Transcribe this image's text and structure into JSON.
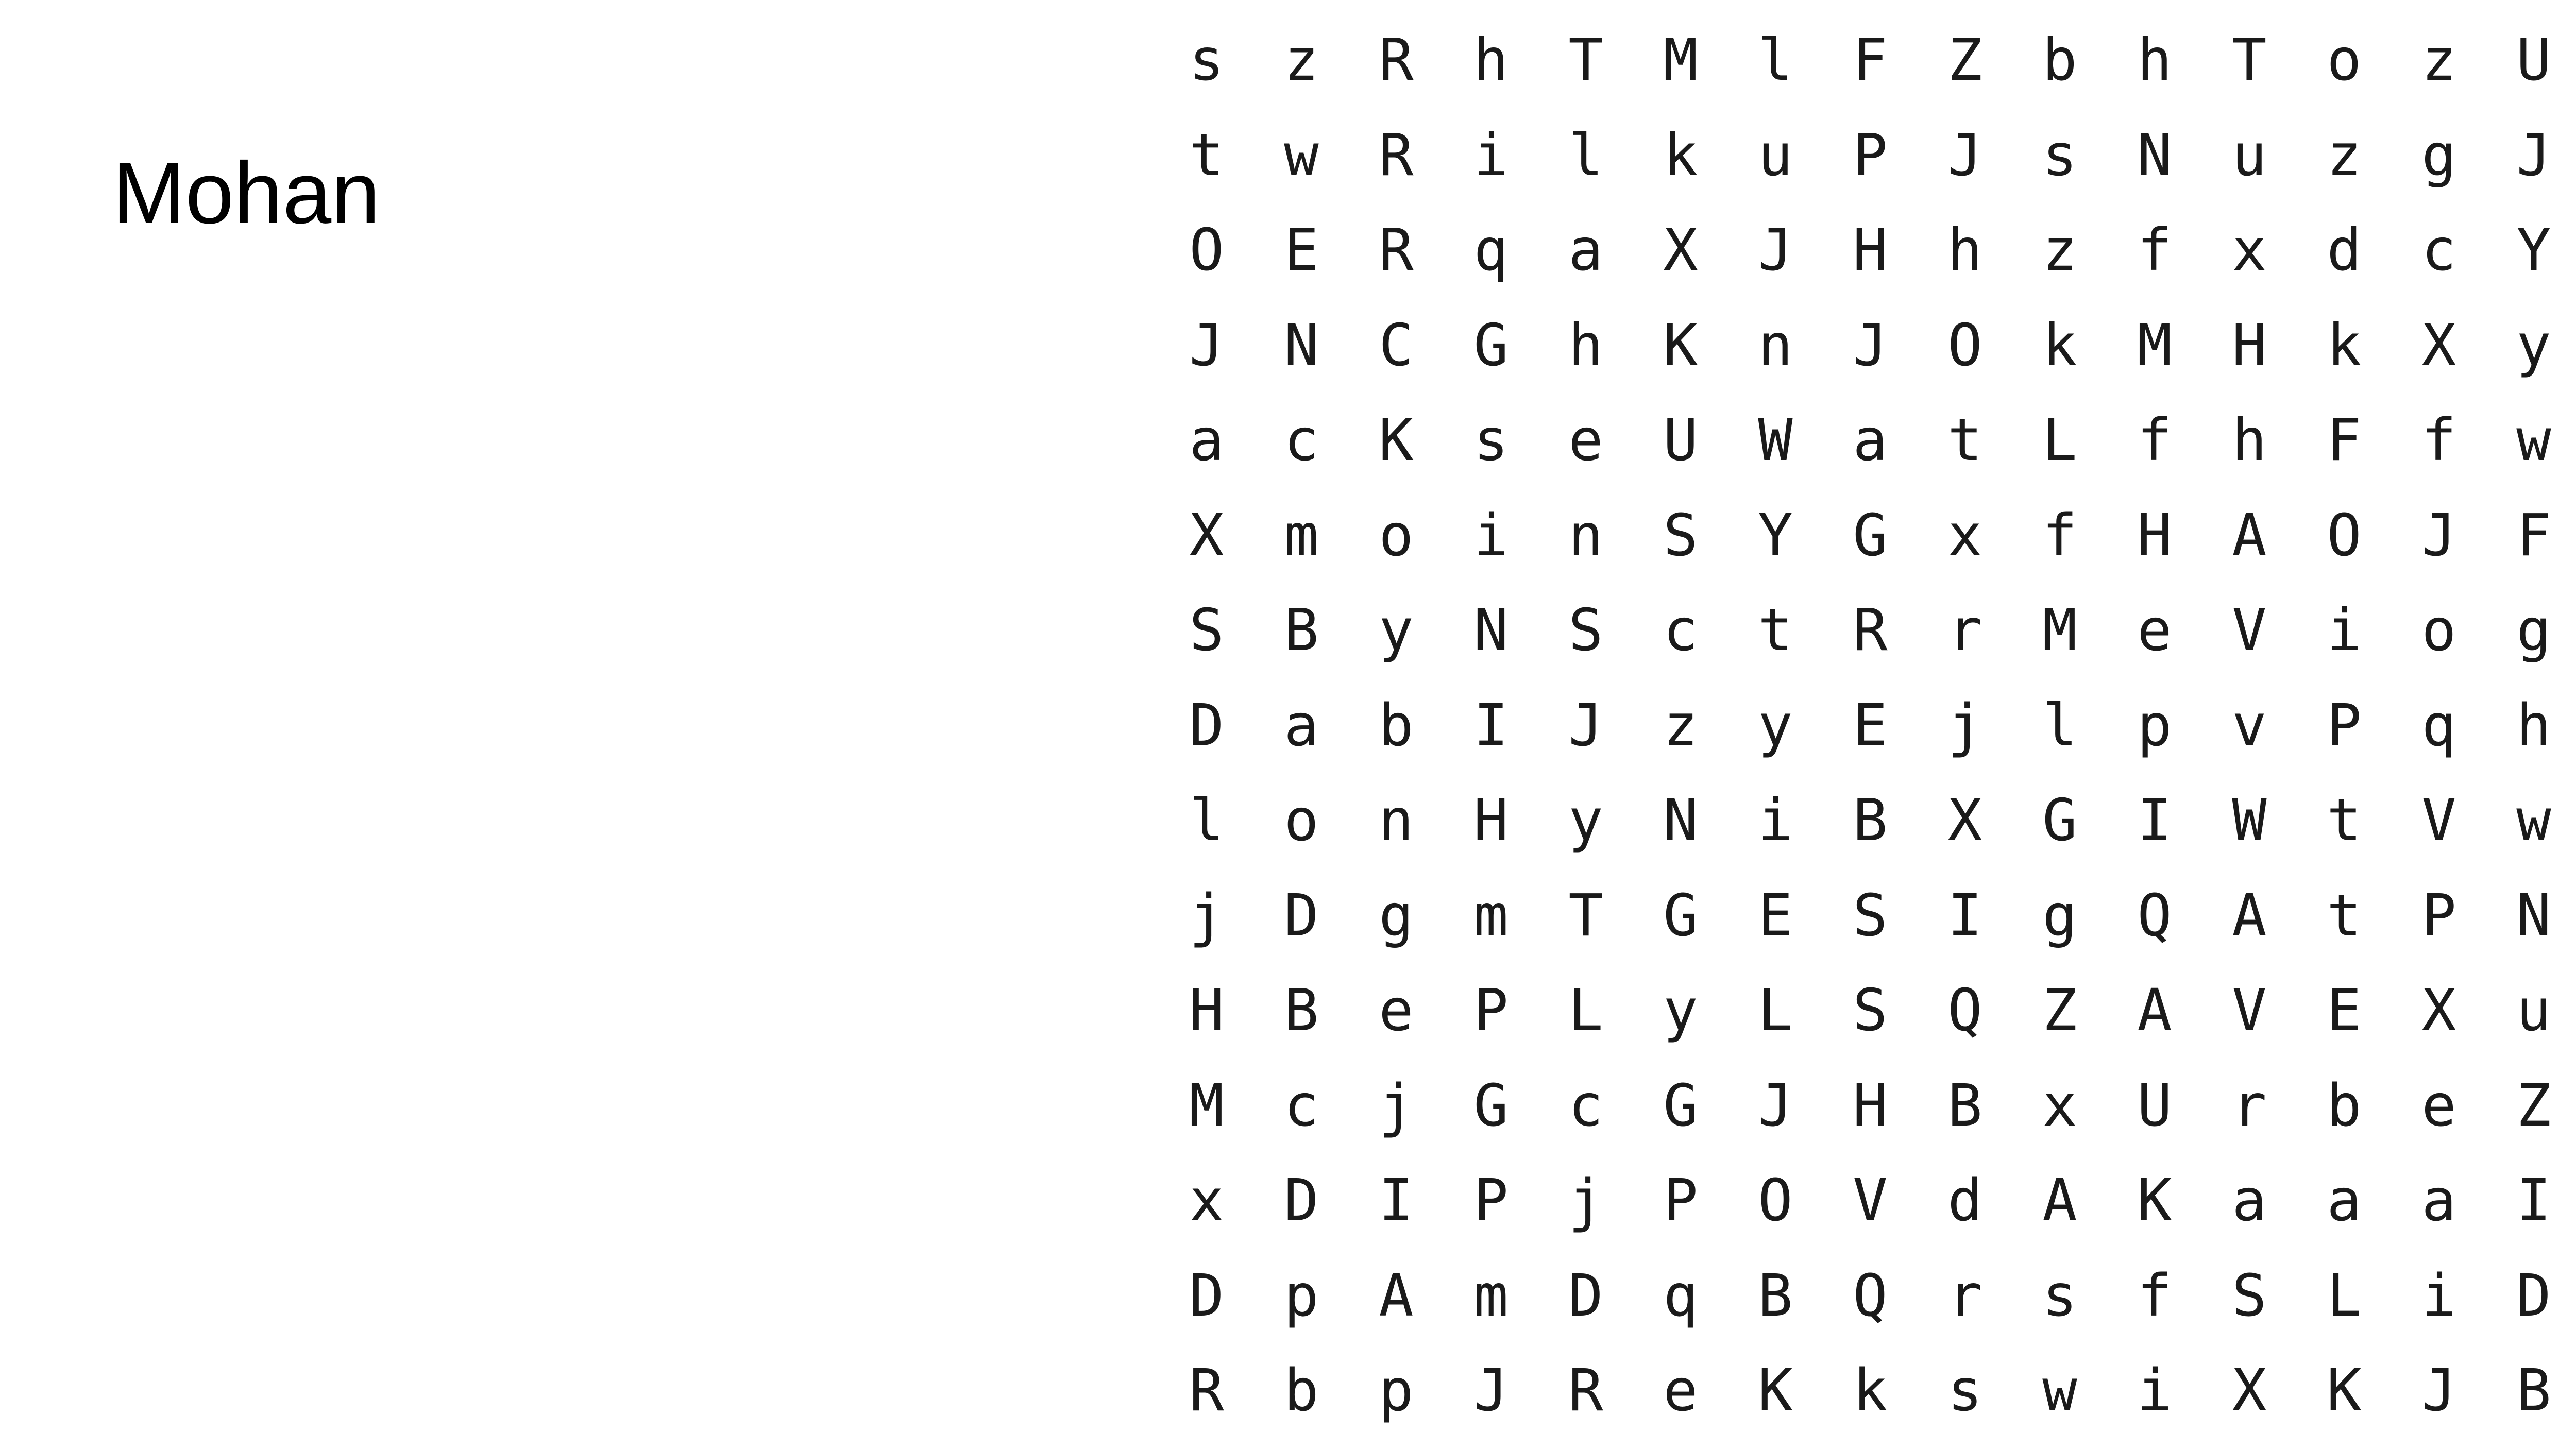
{
  "word_list": [
    "Mohan"
  ],
  "grid": [
    [
      "s",
      "z",
      "R",
      "h",
      "T",
      "M",
      "l",
      "F",
      "Z",
      "b",
      "h",
      "T",
      "o",
      "z",
      "U"
    ],
    [
      "t",
      "w",
      "R",
      "i",
      "l",
      "k",
      "u",
      "P",
      "J",
      "s",
      "N",
      "u",
      "z",
      "g",
      "J"
    ],
    [
      "O",
      "E",
      "R",
      "q",
      "a",
      "X",
      "J",
      "H",
      "h",
      "z",
      "f",
      "x",
      "d",
      "c",
      "Y"
    ],
    [
      "J",
      "N",
      "C",
      "G",
      "h",
      "K",
      "n",
      "J",
      "O",
      "k",
      "M",
      "H",
      "k",
      "X",
      "y"
    ],
    [
      "a",
      "c",
      "K",
      "s",
      "e",
      "U",
      "W",
      "a",
      "t",
      "L",
      "f",
      "h",
      "F",
      "f",
      "w"
    ],
    [
      "X",
      "m",
      "o",
      "i",
      "n",
      "S",
      "Y",
      "G",
      "x",
      "f",
      "H",
      "A",
      "O",
      "J",
      "F"
    ],
    [
      "S",
      "B",
      "y",
      "N",
      "S",
      "c",
      "t",
      "R",
      "r",
      "M",
      "e",
      "V",
      "i",
      "o",
      "g"
    ],
    [
      "D",
      "a",
      "b",
      "I",
      "J",
      "z",
      "y",
      "E",
      "j",
      "l",
      "p",
      "v",
      "P",
      "q",
      "h"
    ],
    [
      "l",
      "o",
      "n",
      "H",
      "y",
      "N",
      "i",
      "B",
      "X",
      "G",
      "I",
      "W",
      "t",
      "V",
      "w"
    ],
    [
      "j",
      "D",
      "g",
      "m",
      "T",
      "G",
      "E",
      "S",
      "I",
      "g",
      "Q",
      "A",
      "t",
      "P",
      "N"
    ],
    [
      "H",
      "B",
      "e",
      "P",
      "L",
      "y",
      "L",
      "S",
      "Q",
      "Z",
      "A",
      "V",
      "E",
      "X",
      "u"
    ],
    [
      "M",
      "c",
      "j",
      "G",
      "c",
      "G",
      "J",
      "H",
      "B",
      "x",
      "U",
      "r",
      "b",
      "e",
      "Z"
    ],
    [
      "x",
      "D",
      "I",
      "P",
      "j",
      "P",
      "O",
      "V",
      "d",
      "A",
      "K",
      "a",
      "a",
      "a",
      "I"
    ],
    [
      "D",
      "p",
      "A",
      "m",
      "D",
      "q",
      "B",
      "Q",
      "r",
      "s",
      "f",
      "S",
      "L",
      "i",
      "D"
    ],
    [
      "R",
      "b",
      "p",
      "J",
      "R",
      "e",
      "K",
      "k",
      "s",
      "w",
      "i",
      "X",
      "K",
      "J",
      "B"
    ]
  ]
}
